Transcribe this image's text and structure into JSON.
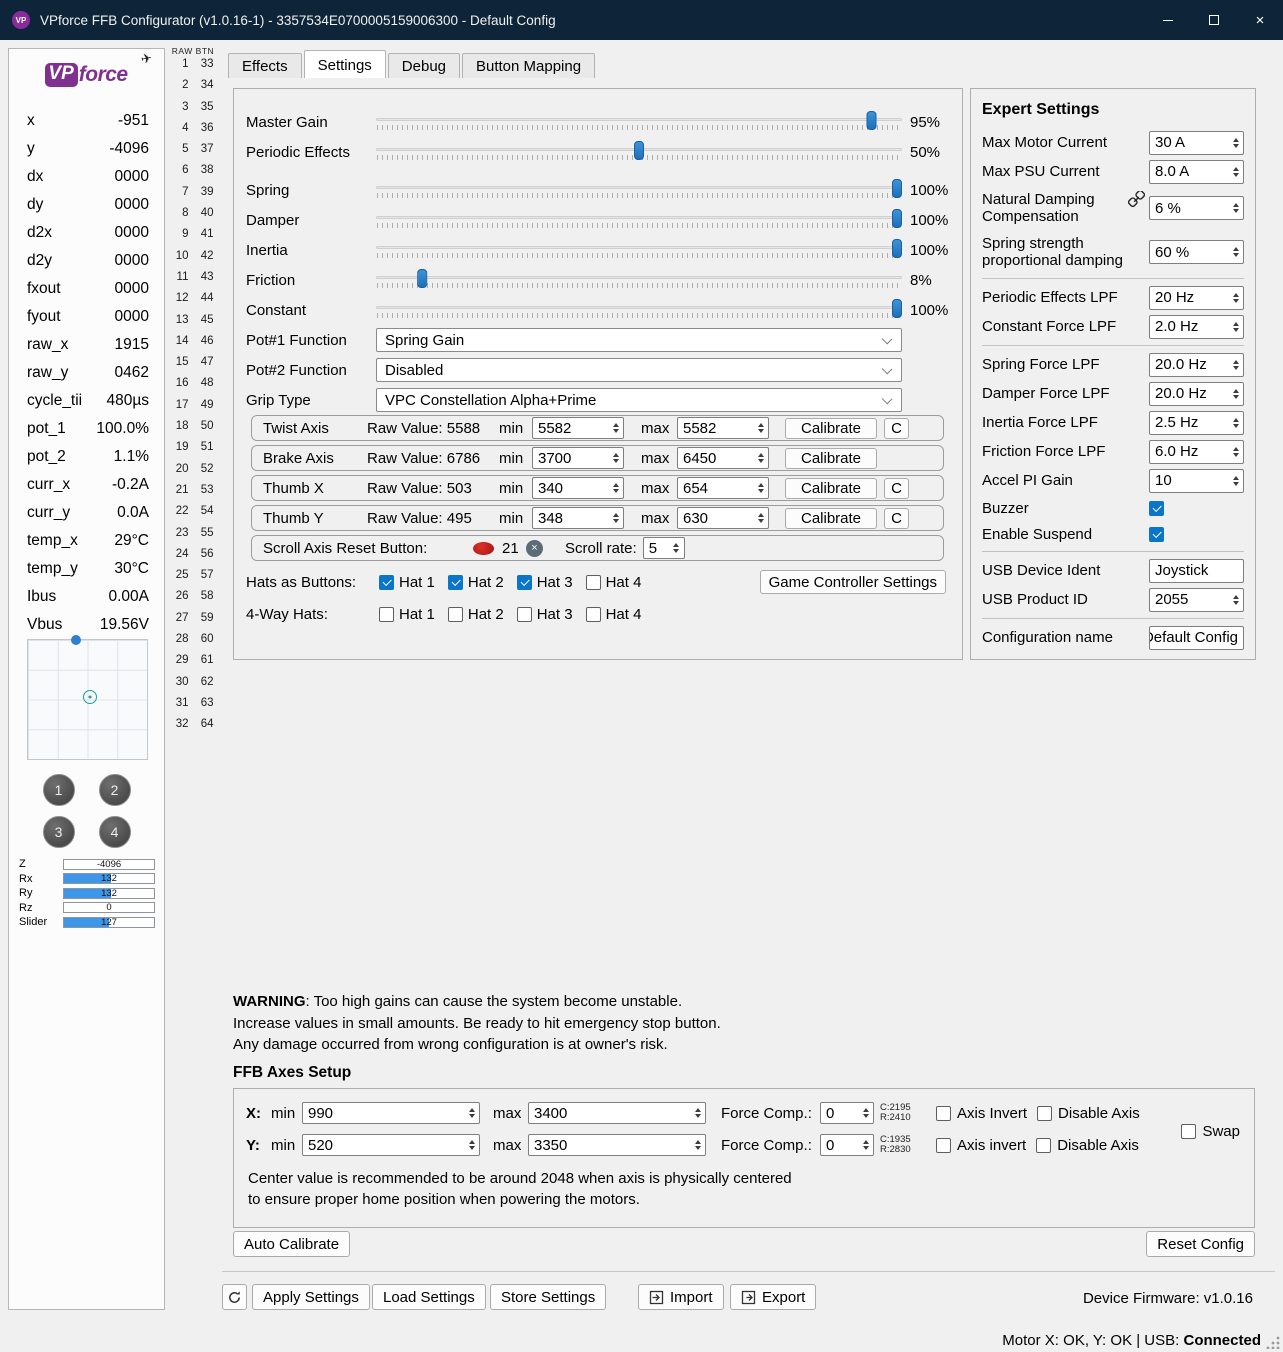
{
  "window": {
    "title": "VPforce FFB Configurator (v1.0.16-1) - 3357534E0700005159006300 - Default Config",
    "app_icon_text": "VP",
    "controls": {
      "close": "×"
    }
  },
  "colors": {
    "titlebar": "#0e2438",
    "accent_blue": "#2079c7",
    "checkbox_blue": "#0b76c9",
    "bar_fill_blue": "#3d96e8",
    "logo_purple": "#80308f",
    "scroll_button_red": "#c01818"
  },
  "icons": [
    "plane-icon",
    "minimize-icon",
    "maximize-icon",
    "close-icon",
    "chevron-down-icon",
    "link-icon",
    "clear-icon",
    "scroll-reset-button-icon",
    "refresh-icon",
    "import-icon",
    "export-icon",
    "resize-grip"
  ],
  "sidebar": {
    "logo_vp": "VP",
    "logo_force": "force",
    "plane_glyph": "✈",
    "telemetry": [
      {
        "label": "x",
        "value": "-951"
      },
      {
        "label": "y",
        "value": "-4096"
      },
      {
        "label": "dx",
        "value": "0000"
      },
      {
        "label": "dy",
        "value": "0000"
      },
      {
        "label": "d2x",
        "value": "0000"
      },
      {
        "label": "d2y",
        "value": "0000"
      },
      {
        "label": "fxout",
        "value": "0000"
      },
      {
        "label": "fyout",
        "value": "0000"
      },
      {
        "label": "raw_x",
        "value": "1915"
      },
      {
        "label": "raw_y",
        "value": "0462"
      },
      {
        "label": "cycle_tii",
        "value": "480µs"
      },
      {
        "label": "pot_1",
        "value": "100.0%"
      },
      {
        "label": "pot_2",
        "value": "1.1%"
      },
      {
        "label": "curr_x",
        "value": "-0.2A"
      },
      {
        "label": "curr_y",
        "value": "0.0A"
      },
      {
        "label": "temp_x",
        "value": "29°C"
      },
      {
        "label": "temp_y",
        "value": "30°C"
      },
      {
        "label": "Ibus",
        "value": "0.00A"
      },
      {
        "label": "Vbus",
        "value": "19.56V"
      }
    ],
    "position_grid": {
      "marker_x_pct": 52,
      "marker_y_pct": 48,
      "dot_x_pct": 40,
      "dot_y_pct": 0
    },
    "buttons": [
      "1",
      "2",
      "3",
      "4"
    ],
    "axis_bars": [
      {
        "label": "Z",
        "value": "-4096",
        "fill_pct": 0
      },
      {
        "label": "Rx",
        "value": "132",
        "fill_pct": 52
      },
      {
        "label": "Ry",
        "value": "132",
        "fill_pct": 52
      },
      {
        "label": "Rz",
        "value": "0",
        "fill_pct": 0
      },
      {
        "label": "Slider",
        "value": "127",
        "fill_pct": 50
      }
    ]
  },
  "raw_buttons": {
    "header": "RAW BTN",
    "col1": [
      1,
      2,
      3,
      4,
      5,
      6,
      7,
      8,
      9,
      10,
      11,
      12,
      13,
      14,
      15,
      16,
      17,
      18,
      19,
      20,
      21,
      22,
      23,
      24,
      25,
      26,
      27,
      28,
      29,
      30,
      31,
      32
    ],
    "col2": [
      33,
      34,
      35,
      36,
      37,
      38,
      39,
      40,
      41,
      42,
      43,
      44,
      45,
      46,
      47,
      48,
      49,
      50,
      51,
      52,
      53,
      54,
      55,
      56,
      57,
      58,
      59,
      60,
      61,
      62,
      63,
      64
    ]
  },
  "tabs": [
    {
      "label": "Effects",
      "active": false
    },
    {
      "label": "Settings",
      "active": true
    },
    {
      "label": "Debug",
      "active": false
    },
    {
      "label": "Button Mapping",
      "active": false
    }
  ],
  "settings": {
    "sliders": [
      {
        "label": "Master Gain",
        "pct": 95,
        "value": "95%",
        "group": 1
      },
      {
        "label": "Periodic Effects",
        "pct": 50,
        "value": "50%",
        "group": 1
      },
      {
        "label": "Spring",
        "pct": 100,
        "value": "100%",
        "group": 2
      },
      {
        "label": "Damper",
        "pct": 100,
        "value": "100%",
        "group": 2
      },
      {
        "label": "Inertia",
        "pct": 100,
        "value": "100%",
        "group": 2
      },
      {
        "label": "Friction",
        "pct": 8,
        "value": "8%",
        "group": 2
      },
      {
        "label": "Constant",
        "pct": 100,
        "value": "100%",
        "group": 2
      }
    ],
    "dropdowns": [
      {
        "label": "Pot#1 Function",
        "value": "Spring Gain"
      },
      {
        "label": "Pot#2 Function",
        "value": "Disabled"
      },
      {
        "label": "Grip Type",
        "value": "VPC Constellation Alpha+Prime"
      }
    ],
    "axis_calibration": [
      {
        "label": "Twist Axis",
        "raw": "Raw Value: 5588",
        "min_label": "min",
        "min": "5582",
        "max_label": "max",
        "max": "5582",
        "calibrate": "Calibrate",
        "c": "C"
      },
      {
        "label": "Brake Axis",
        "raw": "Raw Value: 6786",
        "min_label": "min",
        "min": "3700",
        "max_label": "max",
        "max": "6450",
        "calibrate": "Calibrate",
        "c": null
      },
      {
        "label": "Thumb X",
        "raw": "Raw Value: 503",
        "min_label": "min",
        "min": "340",
        "max_label": "max",
        "max": "654",
        "calibrate": "Calibrate",
        "c": "C"
      },
      {
        "label": "Thumb Y",
        "raw": "Raw Value: 495",
        "min_label": "min",
        "min": "348",
        "max_label": "max",
        "max": "630",
        "calibrate": "Calibrate",
        "c": "C"
      }
    ],
    "scroll_reset": {
      "label": "Scroll Axis Reset Button:",
      "button_number": "21",
      "clear_glyph": "×",
      "rate_label": "Scroll rate:",
      "rate": "5"
    },
    "hats_as_buttons": {
      "label": "Hats as Buttons:",
      "hats": [
        {
          "label": "Hat 1",
          "checked": true
        },
        {
          "label": "Hat 2",
          "checked": true
        },
        {
          "label": "Hat 3",
          "checked": true
        },
        {
          "label": "Hat 4",
          "checked": false
        }
      ],
      "button": "Game Controller Settings"
    },
    "four_way_hats": {
      "label": "4-Way Hats:",
      "hats": [
        {
          "label": "Hat 1",
          "checked": false
        },
        {
          "label": "Hat 2",
          "checked": false
        },
        {
          "label": "Hat 3",
          "checked": false
        },
        {
          "label": "Hat 4",
          "checked": false
        }
      ]
    }
  },
  "expert": {
    "title": "Expert Settings",
    "rows": [
      {
        "type": "spin",
        "label": "Max Motor Current",
        "value": "30 A"
      },
      {
        "type": "spin",
        "label": "Max PSU Current",
        "value": "8.0 A"
      },
      {
        "type": "spin",
        "label": "Natural Damping Compensation",
        "value": "6 %",
        "icon": "link",
        "tall": true
      },
      {
        "type": "spin",
        "label": "Spring strength proportional damping",
        "value": "60 %",
        "tall": true
      },
      {
        "type": "sep"
      },
      {
        "type": "spin",
        "label": "Periodic Effects LPF",
        "value": "20 Hz"
      },
      {
        "type": "spin",
        "label": "Constant Force LPF",
        "value": "2.0 Hz"
      },
      {
        "type": "sep"
      },
      {
        "type": "spin",
        "label": "Spring Force LPF",
        "value": "20.0 Hz"
      },
      {
        "type": "spin",
        "label": "Damper Force LPF",
        "value": "20.0 Hz"
      },
      {
        "type": "spin",
        "label": "Inertia Force LPF",
        "value": "2.5 Hz"
      },
      {
        "type": "spin",
        "label": "Friction Force LPF",
        "value": "6.0 Hz"
      },
      {
        "type": "spin",
        "label": "Accel PI Gain",
        "value": "10"
      },
      {
        "type": "check",
        "label": "Buzzer",
        "checked": true
      },
      {
        "type": "check",
        "label": "Enable Suspend",
        "checked": true
      },
      {
        "type": "sep"
      },
      {
        "type": "text",
        "label": "USB Device Ident",
        "value": "Joystick"
      },
      {
        "type": "spin",
        "label": "USB Product ID",
        "value": "2055"
      },
      {
        "type": "sep"
      },
      {
        "type": "text",
        "label": "Configuration name",
        "value": "Default Config",
        "clip_left": true
      }
    ]
  },
  "warning": {
    "bold": "WARNING",
    "line1": ": Too high gains can cause the system become unstable.",
    "line2": "Increase values in small amounts. Be ready to hit emergency stop button.",
    "line3": "Any damage occurred from wrong configuration is at owner's risk."
  },
  "ffb_axes": {
    "title": "FFB Axes Setup",
    "rows": [
      {
        "axis": "X:",
        "min_label": "min",
        "min": "990",
        "max_label": "max",
        "max": "3400",
        "fc_label": "Force Comp.:",
        "fc": "0",
        "c": "C:2195",
        "r": "R:2410",
        "invert_label": "Axis Invert",
        "invert": false,
        "disable_label": "Disable Axis",
        "disable": false
      },
      {
        "axis": "Y:",
        "min_label": "min",
        "min": "520",
        "max_label": "max",
        "max": "3350",
        "fc_label": "Force Comp.:",
        "fc": "0",
        "c": "C:1935",
        "r": "R:2830",
        "invert_label": "Axis invert",
        "invert": false,
        "disable_label": "Disable Axis",
        "disable": false
      }
    ],
    "swap_label": "Swap",
    "swap_checked": false,
    "note1": "Center value is recommended to be around 2048 when axis is physically centered",
    "note2": "to ensure proper home position when powering the motors."
  },
  "actions": {
    "auto_calibrate": "Auto Calibrate",
    "reset_config": "Reset Config",
    "apply": "Apply Settings",
    "load": "Load Settings",
    "store": "Store Settings",
    "import": "Import",
    "export": "Export",
    "firmware": "Device Firmware: v1.0.16"
  },
  "statusbar": {
    "text": "Motor X: OK, Y: OK | USB: ",
    "status": "Connected"
  }
}
